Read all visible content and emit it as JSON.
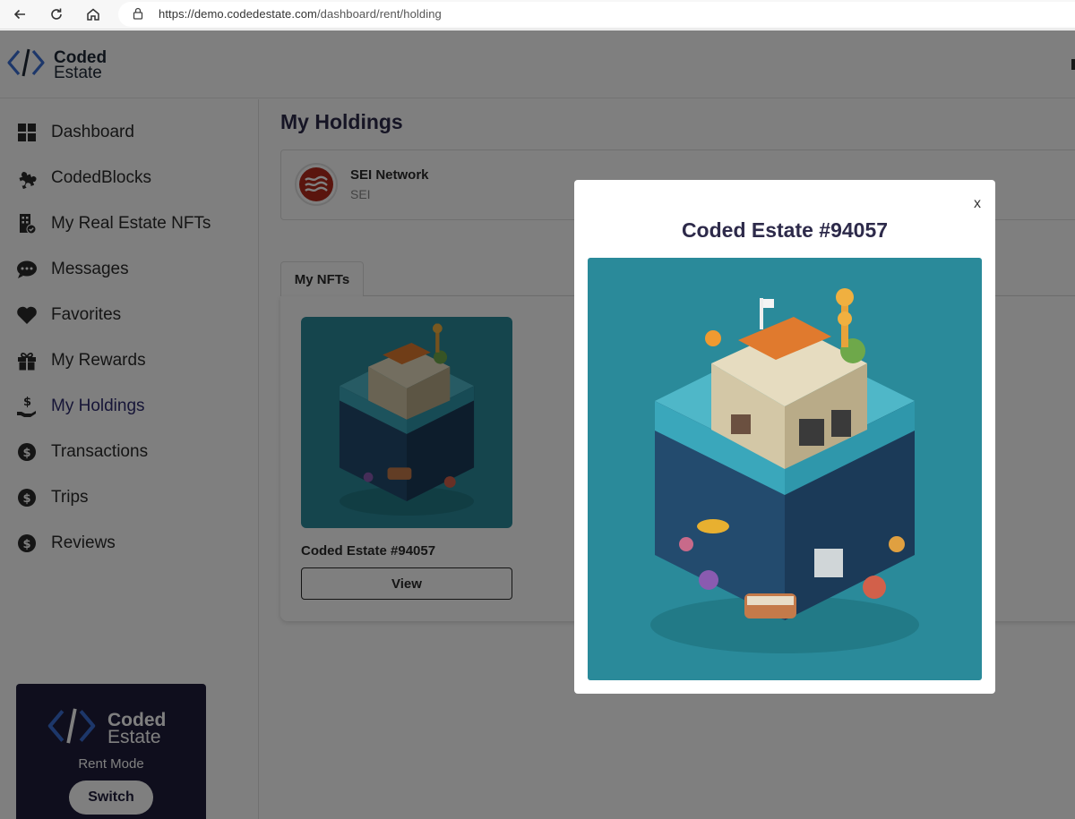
{
  "browser": {
    "url_host": "https://demo.codedestate.com",
    "url_path": "/dashboard/rent/holding"
  },
  "brand": {
    "name_line1": "Coded",
    "name_line2": "Estate"
  },
  "sidebar": {
    "items": [
      {
        "label": "Dashboard",
        "icon": "dashboard-grid-icon"
      },
      {
        "label": "CodedBlocks",
        "icon": "puzzle-icon"
      },
      {
        "label": "My Real Estate NFTs",
        "icon": "building-icon"
      },
      {
        "label": "Messages",
        "icon": "chat-bubble-icon"
      },
      {
        "label": "Favorites",
        "icon": "heart-icon"
      },
      {
        "label": "My Rewards",
        "icon": "gift-icon"
      },
      {
        "label": "My Holdings",
        "icon": "hand-dollar-icon",
        "active": true
      },
      {
        "label": "Transactions",
        "icon": "dollar-circle-icon"
      },
      {
        "label": "Trips",
        "icon": "dollar-circle-icon"
      },
      {
        "label": "Reviews",
        "icon": "dollar-circle-icon"
      }
    ],
    "mode_card": {
      "name_line1": "Coded",
      "name_line2": "Estate",
      "mode_label": "Rent Mode",
      "switch_label": "Switch"
    }
  },
  "main": {
    "page_title": "My Holdings",
    "network": {
      "name": "SEI Network",
      "symbol": "SEI"
    },
    "tab_label": "My NFTs",
    "nfts": [
      {
        "name": "Coded Estate #94057",
        "button_label": "View"
      }
    ]
  },
  "modal": {
    "title": "Coded Estate #94057",
    "close_label": "x"
  },
  "colors": {
    "accent_dark": "#2d2a4a",
    "mode_card_bg": "#1f1d3a",
    "logo_blue": "#3b6fd4",
    "nft_teal": "#2a8a9a"
  }
}
